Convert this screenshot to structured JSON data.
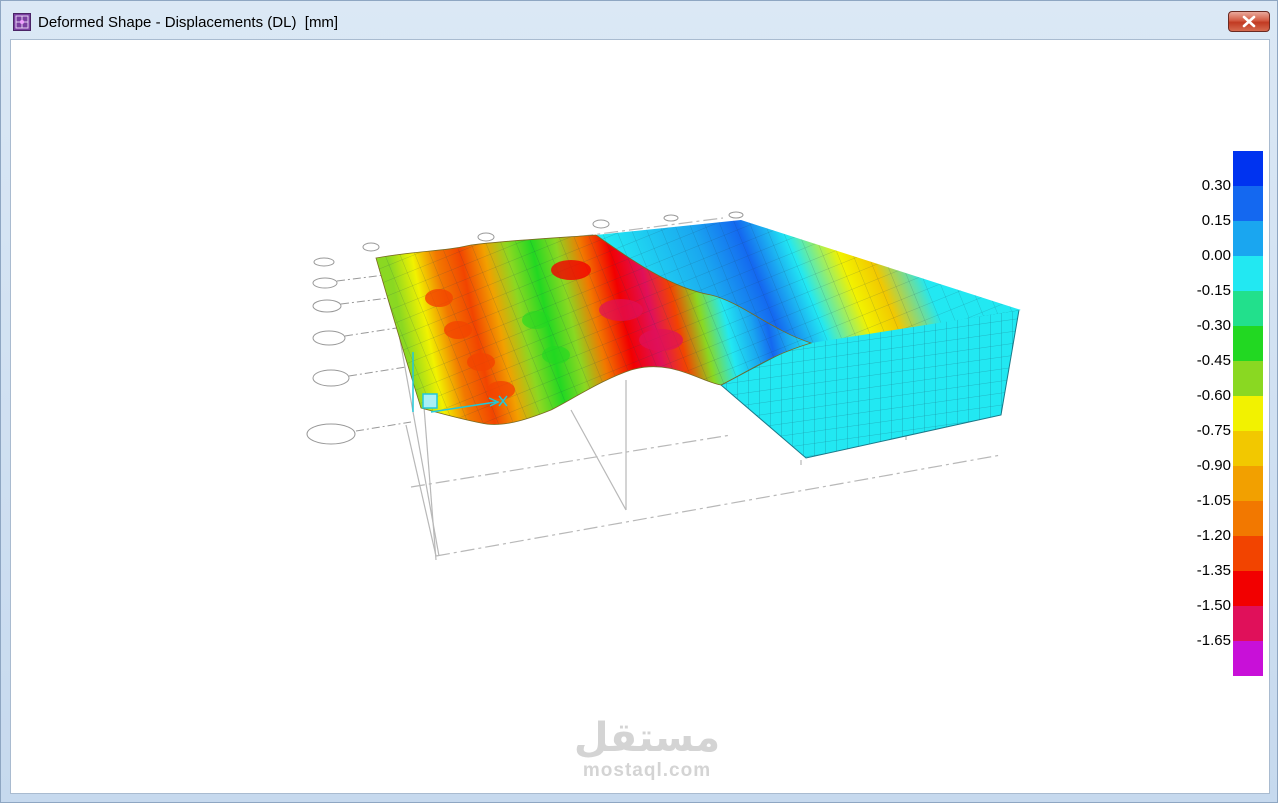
{
  "window": {
    "title": "Deformed Shape - Displacements (DL)  [mm]",
    "app_icon": "sap2000-model-icon",
    "close_icon": "close-icon"
  },
  "legend": {
    "labels": [
      "0.30",
      "0.15",
      "0.00",
      "-0.15",
      "-0.30",
      "-0.45",
      "-0.60",
      "-0.75",
      "-0.90",
      "-1.05",
      "-1.20",
      "-1.35",
      "-1.50",
      "-1.65"
    ],
    "colors": [
      "#0033f0",
      "#1468f0",
      "#1aa6f0",
      "#22e8f2",
      "#22e08c",
      "#22d822",
      "#8ad822",
      "#f2f200",
      "#f2c800",
      "#f2a000",
      "#f27800",
      "#f24400",
      "#f20000",
      "#e0105a",
      "#c810d8"
    ]
  },
  "watermark": {
    "arabic": "مستقل",
    "latin": "mostaql.com"
  }
}
